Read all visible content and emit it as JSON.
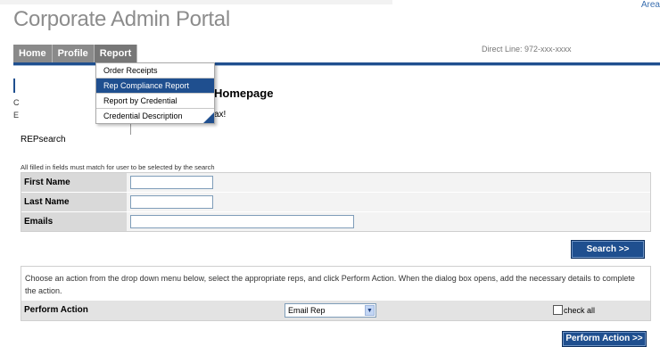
{
  "header": {
    "title": "Corporate Admin Portal",
    "corner_link": "Area",
    "contact_text": "Direct Line: 972-xxx-xxxx"
  },
  "nav": {
    "tabs": [
      {
        "label": "Home"
      },
      {
        "label": "Profile"
      },
      {
        "label": "Report"
      }
    ]
  },
  "dropdown": {
    "items": [
      {
        "label": "Order Receipts"
      },
      {
        "label": "Rep Compliance Report"
      },
      {
        "label": "Report by Credential"
      },
      {
        "label": "Credential Description"
      }
    ]
  },
  "left": {
    "l1": "C",
    "l2": "E"
  },
  "main": {
    "heading": "Homepage",
    "greeting": "ax!"
  },
  "search": {
    "section_label": "REPsearch",
    "instructions": "All filled in fields must match for user to be selected by the search",
    "fields": [
      {
        "label": "First Name",
        "value": ""
      },
      {
        "label": "Last Name",
        "value": ""
      },
      {
        "label": "Emails",
        "value": ""
      }
    ],
    "button_label": "Search >>"
  },
  "action": {
    "description": "Choose an action from the drop down menu below, select the appropriate reps, and click Perform Action. When the dialog box opens, add the necessary details to complete the action.",
    "label": "Perform Action",
    "selected": "Email Rep",
    "check_all_label": "check all",
    "button_label": "Perform Action >>"
  }
}
